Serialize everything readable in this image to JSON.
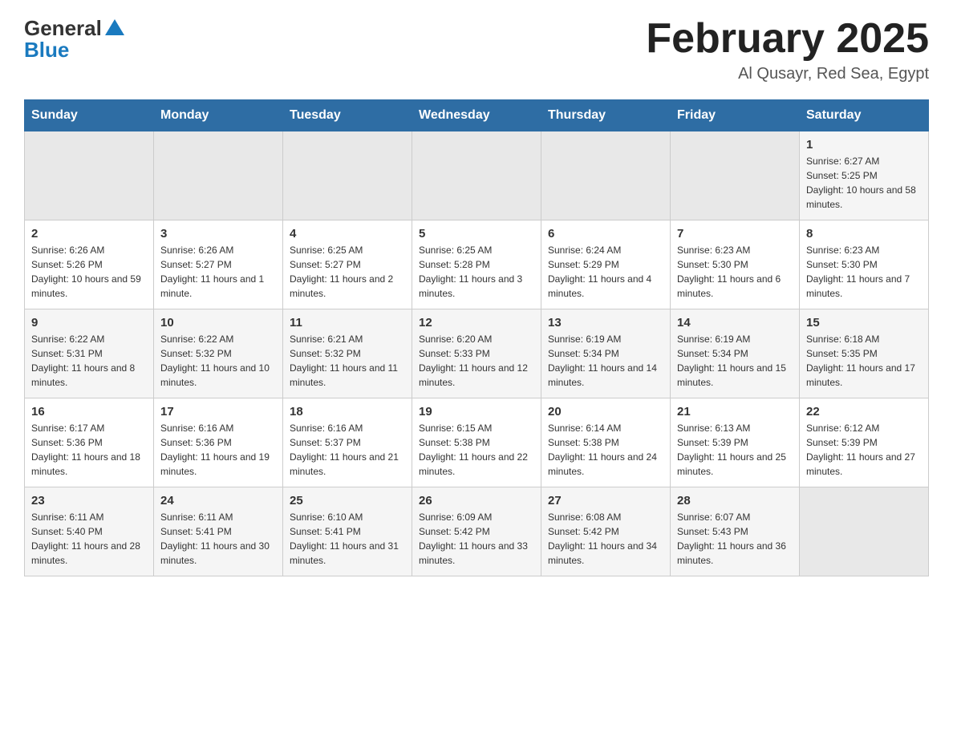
{
  "header": {
    "logo_general": "General",
    "logo_blue": "Blue",
    "month_title": "February 2025",
    "location": "Al Qusayr, Red Sea, Egypt"
  },
  "days_of_week": [
    "Sunday",
    "Monday",
    "Tuesday",
    "Wednesday",
    "Thursday",
    "Friday",
    "Saturday"
  ],
  "weeks": [
    [
      {
        "num": "",
        "sunrise": "",
        "sunset": "",
        "daylight": "",
        "empty": true
      },
      {
        "num": "",
        "sunrise": "",
        "sunset": "",
        "daylight": "",
        "empty": true
      },
      {
        "num": "",
        "sunrise": "",
        "sunset": "",
        "daylight": "",
        "empty": true
      },
      {
        "num": "",
        "sunrise": "",
        "sunset": "",
        "daylight": "",
        "empty": true
      },
      {
        "num": "",
        "sunrise": "",
        "sunset": "",
        "daylight": "",
        "empty": true
      },
      {
        "num": "",
        "sunrise": "",
        "sunset": "",
        "daylight": "",
        "empty": true
      },
      {
        "num": "1",
        "sunrise": "Sunrise: 6:27 AM",
        "sunset": "Sunset: 5:25 PM",
        "daylight": "Daylight: 10 hours and 58 minutes.",
        "empty": false
      }
    ],
    [
      {
        "num": "2",
        "sunrise": "Sunrise: 6:26 AM",
        "sunset": "Sunset: 5:26 PM",
        "daylight": "Daylight: 10 hours and 59 minutes.",
        "empty": false
      },
      {
        "num": "3",
        "sunrise": "Sunrise: 6:26 AM",
        "sunset": "Sunset: 5:27 PM",
        "daylight": "Daylight: 11 hours and 1 minute.",
        "empty": false
      },
      {
        "num": "4",
        "sunrise": "Sunrise: 6:25 AM",
        "sunset": "Sunset: 5:27 PM",
        "daylight": "Daylight: 11 hours and 2 minutes.",
        "empty": false
      },
      {
        "num": "5",
        "sunrise": "Sunrise: 6:25 AM",
        "sunset": "Sunset: 5:28 PM",
        "daylight": "Daylight: 11 hours and 3 minutes.",
        "empty": false
      },
      {
        "num": "6",
        "sunrise": "Sunrise: 6:24 AM",
        "sunset": "Sunset: 5:29 PM",
        "daylight": "Daylight: 11 hours and 4 minutes.",
        "empty": false
      },
      {
        "num": "7",
        "sunrise": "Sunrise: 6:23 AM",
        "sunset": "Sunset: 5:30 PM",
        "daylight": "Daylight: 11 hours and 6 minutes.",
        "empty": false
      },
      {
        "num": "8",
        "sunrise": "Sunrise: 6:23 AM",
        "sunset": "Sunset: 5:30 PM",
        "daylight": "Daylight: 11 hours and 7 minutes.",
        "empty": false
      }
    ],
    [
      {
        "num": "9",
        "sunrise": "Sunrise: 6:22 AM",
        "sunset": "Sunset: 5:31 PM",
        "daylight": "Daylight: 11 hours and 8 minutes.",
        "empty": false
      },
      {
        "num": "10",
        "sunrise": "Sunrise: 6:22 AM",
        "sunset": "Sunset: 5:32 PM",
        "daylight": "Daylight: 11 hours and 10 minutes.",
        "empty": false
      },
      {
        "num": "11",
        "sunrise": "Sunrise: 6:21 AM",
        "sunset": "Sunset: 5:32 PM",
        "daylight": "Daylight: 11 hours and 11 minutes.",
        "empty": false
      },
      {
        "num": "12",
        "sunrise": "Sunrise: 6:20 AM",
        "sunset": "Sunset: 5:33 PM",
        "daylight": "Daylight: 11 hours and 12 minutes.",
        "empty": false
      },
      {
        "num": "13",
        "sunrise": "Sunrise: 6:19 AM",
        "sunset": "Sunset: 5:34 PM",
        "daylight": "Daylight: 11 hours and 14 minutes.",
        "empty": false
      },
      {
        "num": "14",
        "sunrise": "Sunrise: 6:19 AM",
        "sunset": "Sunset: 5:34 PM",
        "daylight": "Daylight: 11 hours and 15 minutes.",
        "empty": false
      },
      {
        "num": "15",
        "sunrise": "Sunrise: 6:18 AM",
        "sunset": "Sunset: 5:35 PM",
        "daylight": "Daylight: 11 hours and 17 minutes.",
        "empty": false
      }
    ],
    [
      {
        "num": "16",
        "sunrise": "Sunrise: 6:17 AM",
        "sunset": "Sunset: 5:36 PM",
        "daylight": "Daylight: 11 hours and 18 minutes.",
        "empty": false
      },
      {
        "num": "17",
        "sunrise": "Sunrise: 6:16 AM",
        "sunset": "Sunset: 5:36 PM",
        "daylight": "Daylight: 11 hours and 19 minutes.",
        "empty": false
      },
      {
        "num": "18",
        "sunrise": "Sunrise: 6:16 AM",
        "sunset": "Sunset: 5:37 PM",
        "daylight": "Daylight: 11 hours and 21 minutes.",
        "empty": false
      },
      {
        "num": "19",
        "sunrise": "Sunrise: 6:15 AM",
        "sunset": "Sunset: 5:38 PM",
        "daylight": "Daylight: 11 hours and 22 minutes.",
        "empty": false
      },
      {
        "num": "20",
        "sunrise": "Sunrise: 6:14 AM",
        "sunset": "Sunset: 5:38 PM",
        "daylight": "Daylight: 11 hours and 24 minutes.",
        "empty": false
      },
      {
        "num": "21",
        "sunrise": "Sunrise: 6:13 AM",
        "sunset": "Sunset: 5:39 PM",
        "daylight": "Daylight: 11 hours and 25 minutes.",
        "empty": false
      },
      {
        "num": "22",
        "sunrise": "Sunrise: 6:12 AM",
        "sunset": "Sunset: 5:39 PM",
        "daylight": "Daylight: 11 hours and 27 minutes.",
        "empty": false
      }
    ],
    [
      {
        "num": "23",
        "sunrise": "Sunrise: 6:11 AM",
        "sunset": "Sunset: 5:40 PM",
        "daylight": "Daylight: 11 hours and 28 minutes.",
        "empty": false
      },
      {
        "num": "24",
        "sunrise": "Sunrise: 6:11 AM",
        "sunset": "Sunset: 5:41 PM",
        "daylight": "Daylight: 11 hours and 30 minutes.",
        "empty": false
      },
      {
        "num": "25",
        "sunrise": "Sunrise: 6:10 AM",
        "sunset": "Sunset: 5:41 PM",
        "daylight": "Daylight: 11 hours and 31 minutes.",
        "empty": false
      },
      {
        "num": "26",
        "sunrise": "Sunrise: 6:09 AM",
        "sunset": "Sunset: 5:42 PM",
        "daylight": "Daylight: 11 hours and 33 minutes.",
        "empty": false
      },
      {
        "num": "27",
        "sunrise": "Sunrise: 6:08 AM",
        "sunset": "Sunset: 5:42 PM",
        "daylight": "Daylight: 11 hours and 34 minutes.",
        "empty": false
      },
      {
        "num": "28",
        "sunrise": "Sunrise: 6:07 AM",
        "sunset": "Sunset: 5:43 PM",
        "daylight": "Daylight: 11 hours and 36 minutes.",
        "empty": false
      },
      {
        "num": "",
        "sunrise": "",
        "sunset": "",
        "daylight": "",
        "empty": true
      }
    ]
  ]
}
